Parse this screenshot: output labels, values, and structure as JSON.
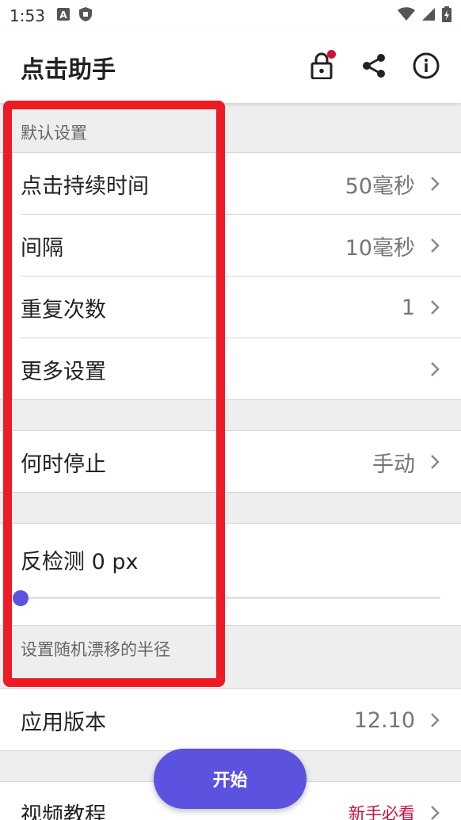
{
  "status_bar": {
    "time": "1:53",
    "icons": [
      "font-icon",
      "shield-icon",
      "wifi-icon",
      "signal-icon",
      "battery-charging-icon"
    ]
  },
  "app_bar": {
    "title": "点击助手",
    "actions": [
      "lock-icon",
      "share-icon",
      "info-icon"
    ],
    "badge_color": "#d0103a"
  },
  "default_settings": {
    "header": "默认设置",
    "items": [
      {
        "label": "点击持续时间",
        "value": "50毫秒"
      },
      {
        "label": "间隔",
        "value": "10毫秒"
      },
      {
        "label": "重复次数",
        "value": "1"
      },
      {
        "label": "更多设置",
        "value": ""
      }
    ]
  },
  "stop": {
    "label": "何时停止",
    "value": "手动"
  },
  "anti_detect": {
    "label": "反检测 0 px",
    "slider_value": 0,
    "hint": "设置随机漂移的半径"
  },
  "about": {
    "app_version_label": "应用版本",
    "app_version_value": "12.10",
    "tutorial_label": "视频教程",
    "tutorial_value": "新手必看"
  },
  "fab": {
    "label": "开始"
  },
  "colors": {
    "accent": "#5b52e0",
    "annotation": "#ec1b24",
    "tutorial_highlight": "#c4123f"
  }
}
